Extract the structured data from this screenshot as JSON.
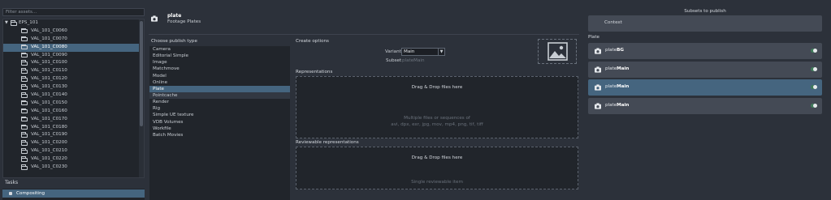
{
  "filter": {
    "placeholder": "Filter assets..."
  },
  "assets": {
    "root": "EPS_101",
    "items": [
      "VAL_101_C0060",
      "VAL_101_C0070",
      "VAL_101_C0080",
      "VAL_101_C0090",
      "VAL_101_C0100",
      "VAL_101_C0110",
      "VAL_101_C0120",
      "VAL_101_C0130",
      "VAL_101_C0140",
      "VAL_101_C0150",
      "VAL_101_C0160",
      "VAL_101_C0170",
      "VAL_101_C0180",
      "VAL_101_C0190",
      "VAL_101_C0200",
      "VAL_101_C0210",
      "VAL_101_C0220",
      "VAL_101_C0230"
    ],
    "selected": "VAL_101_C0080"
  },
  "tasks": {
    "label": "Tasks",
    "items": [
      "Compositing"
    ],
    "selected": "Compositing"
  },
  "header": {
    "title": "plate",
    "subtitle": "Footage Plates",
    "icon": "camera-icon"
  },
  "families": {
    "label": "Choose publish type",
    "items": [
      "Camera",
      "Editorial Simple",
      "Image",
      "Matchmove",
      "Model",
      "Online",
      "Plate",
      "Pointcache",
      "Render",
      "Rig",
      "Simple UE texture",
      "VDB Volumes",
      "Workfile",
      "Batch Movies"
    ],
    "selected": "Plate",
    "hovered": "Pointcache"
  },
  "create": {
    "label": "Create options",
    "variant_label": "Variant",
    "variant_value": "Main",
    "subset_label": "Subset",
    "subset_value": "plateMain",
    "thumbnail_icon": "image-icon"
  },
  "representations": {
    "label": "Representations",
    "drop_title": "Drag & Drop files here",
    "hint_line1": "Multiple files or sequences of",
    "hint_line2": "avi, dpx, exr, jpg, mov, mp4, png, tif, tiff"
  },
  "reviewable": {
    "label": "Reviewable representations",
    "drop_title": "Drag & Drop files here",
    "hint": "Single reviewable item"
  },
  "subsets": {
    "title": "Subsets to publish",
    "context_label": "Context",
    "group_label": "Plate",
    "items": [
      {
        "prefix": "plate",
        "variant": "BG",
        "enabled": true
      },
      {
        "prefix": "plate",
        "variant": "Main",
        "enabled": true
      },
      {
        "prefix": "plate",
        "variant": "Main",
        "enabled": true
      },
      {
        "prefix": "plate",
        "variant": "Main",
        "enabled": true
      }
    ],
    "selected_index": 2
  },
  "colors": {
    "background": "#2c313a",
    "panel": "#21252b",
    "selection": "#45657f",
    "card": "#444a55",
    "toggle_on": "#3f7a59"
  }
}
